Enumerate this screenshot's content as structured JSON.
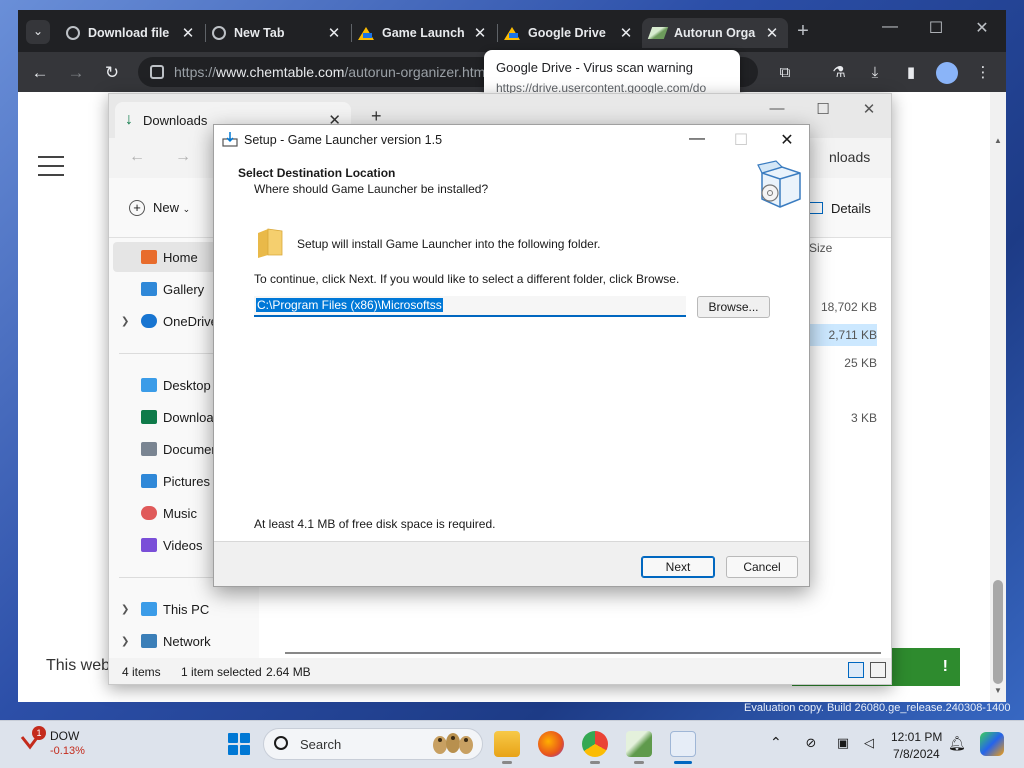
{
  "chrome": {
    "tabs": [
      {
        "label": "Download file",
        "icon": "globe-icon"
      },
      {
        "label": "New Tab",
        "icon": "globe-icon"
      },
      {
        "label": "Game Launch",
        "icon": "google-drive-icon"
      },
      {
        "label": "Google Drive",
        "icon": "google-drive-icon"
      },
      {
        "label": "Autorun Orga",
        "icon": "autorun-organizer-icon"
      }
    ],
    "tab_menu": "⌄",
    "new_tab": "+",
    "url_prefix": "https://",
    "url_host": "www.chemtable.com",
    "url_path": "/autorun-organizer.htm",
    "hovercard_title": "Google Drive - Virus scan warning",
    "hovercard_url": "https://drive.usercontent.google.com/do"
  },
  "webpage": {
    "bottom_text": "This web",
    "green_button": "!"
  },
  "explorer": {
    "tab_label": "Downloads",
    "breadcrumb": "nloads",
    "new_label": "New",
    "details_label": "Details",
    "size_header": "Size",
    "sizes": [
      "18,702 KB",
      "2,711 KB",
      "25 KB",
      "3 KB"
    ],
    "nav": [
      {
        "label": "Home",
        "icon_color": "#e86c2c"
      },
      {
        "label": "Gallery",
        "icon_color": "#2f88d8"
      },
      {
        "label": "OneDrive",
        "icon_color": "#1875d1"
      },
      {
        "label": "Desktop",
        "icon_color": "#3b9ce8"
      },
      {
        "label": "Downloads",
        "icon_color": "#0f7b4a"
      },
      {
        "label": "Documents",
        "icon_color": "#7a8592"
      },
      {
        "label": "Pictures",
        "icon_color": "#2f88d8"
      },
      {
        "label": "Music",
        "icon_color": "#e05a5a"
      },
      {
        "label": "Videos",
        "icon_color": "#7a4fd8"
      },
      {
        "label": "This PC",
        "icon_color": "#3b9ce8"
      },
      {
        "label": "Network",
        "icon_color": "#3b7fb8"
      }
    ],
    "status_items": "4 items",
    "status_selected": "1 item selected",
    "status_size": "2.64 MB"
  },
  "dialog": {
    "title": "Setup - Game Launcher version 1.5",
    "heading": "Select Destination Location",
    "subheading": "Where should Game Launcher be installed?",
    "install_text": "Setup will install Game Launcher into the following folder.",
    "continue_text": "To continue, click Next. If you would like to select a different folder, click Browse.",
    "path_value": "C:\\Program Files (x86)\\Microsoftss",
    "browse_label": "Browse...",
    "disk_text": "At least 4.1 MB of free disk space is required.",
    "next_label": "Next",
    "cancel_label": "Cancel"
  },
  "taskbar": {
    "stock_badge": "1",
    "stock_name": "DOW",
    "stock_change": "-0.13%",
    "search_label": "Search",
    "time": "12:01 PM",
    "date": "7/8/2024",
    "evaluation": "Evaluation copy. Build 26080.ge_release.240308-1400"
  }
}
